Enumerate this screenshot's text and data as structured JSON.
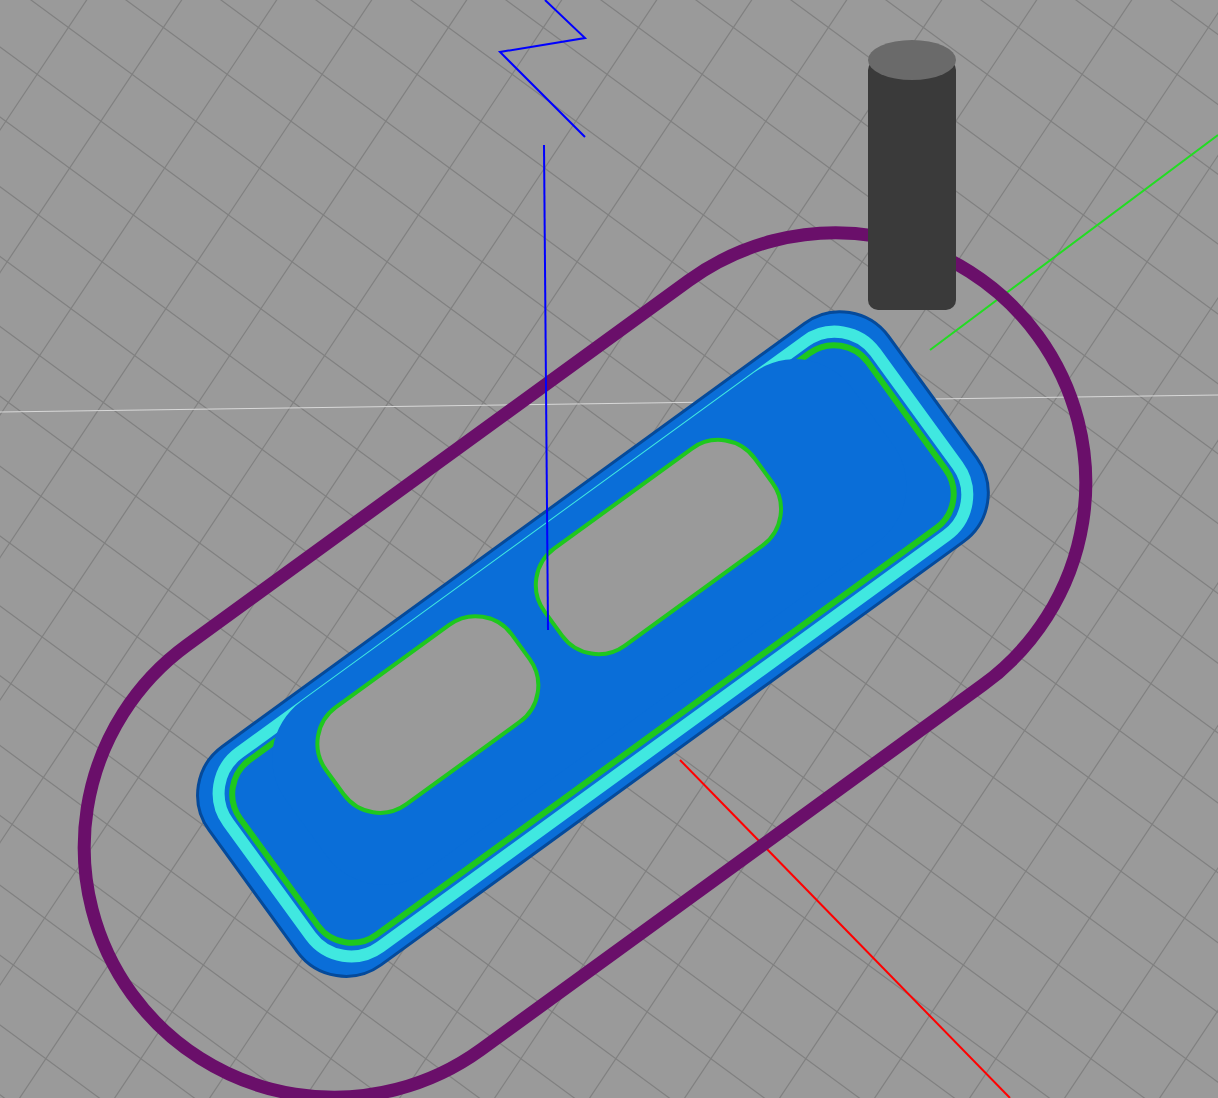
{
  "axes": [
    {
      "color": "#ff0000"
    },
    {
      "color": "#22dd22"
    },
    {
      "color": "#0000ff"
    }
  ],
  "toolpaths": [
    {
      "color": "#6a0f6a"
    },
    {
      "color": "#0a6ed8"
    },
    {
      "color": "#40e8e0"
    },
    {
      "color": "#1ec81e"
    }
  ]
}
